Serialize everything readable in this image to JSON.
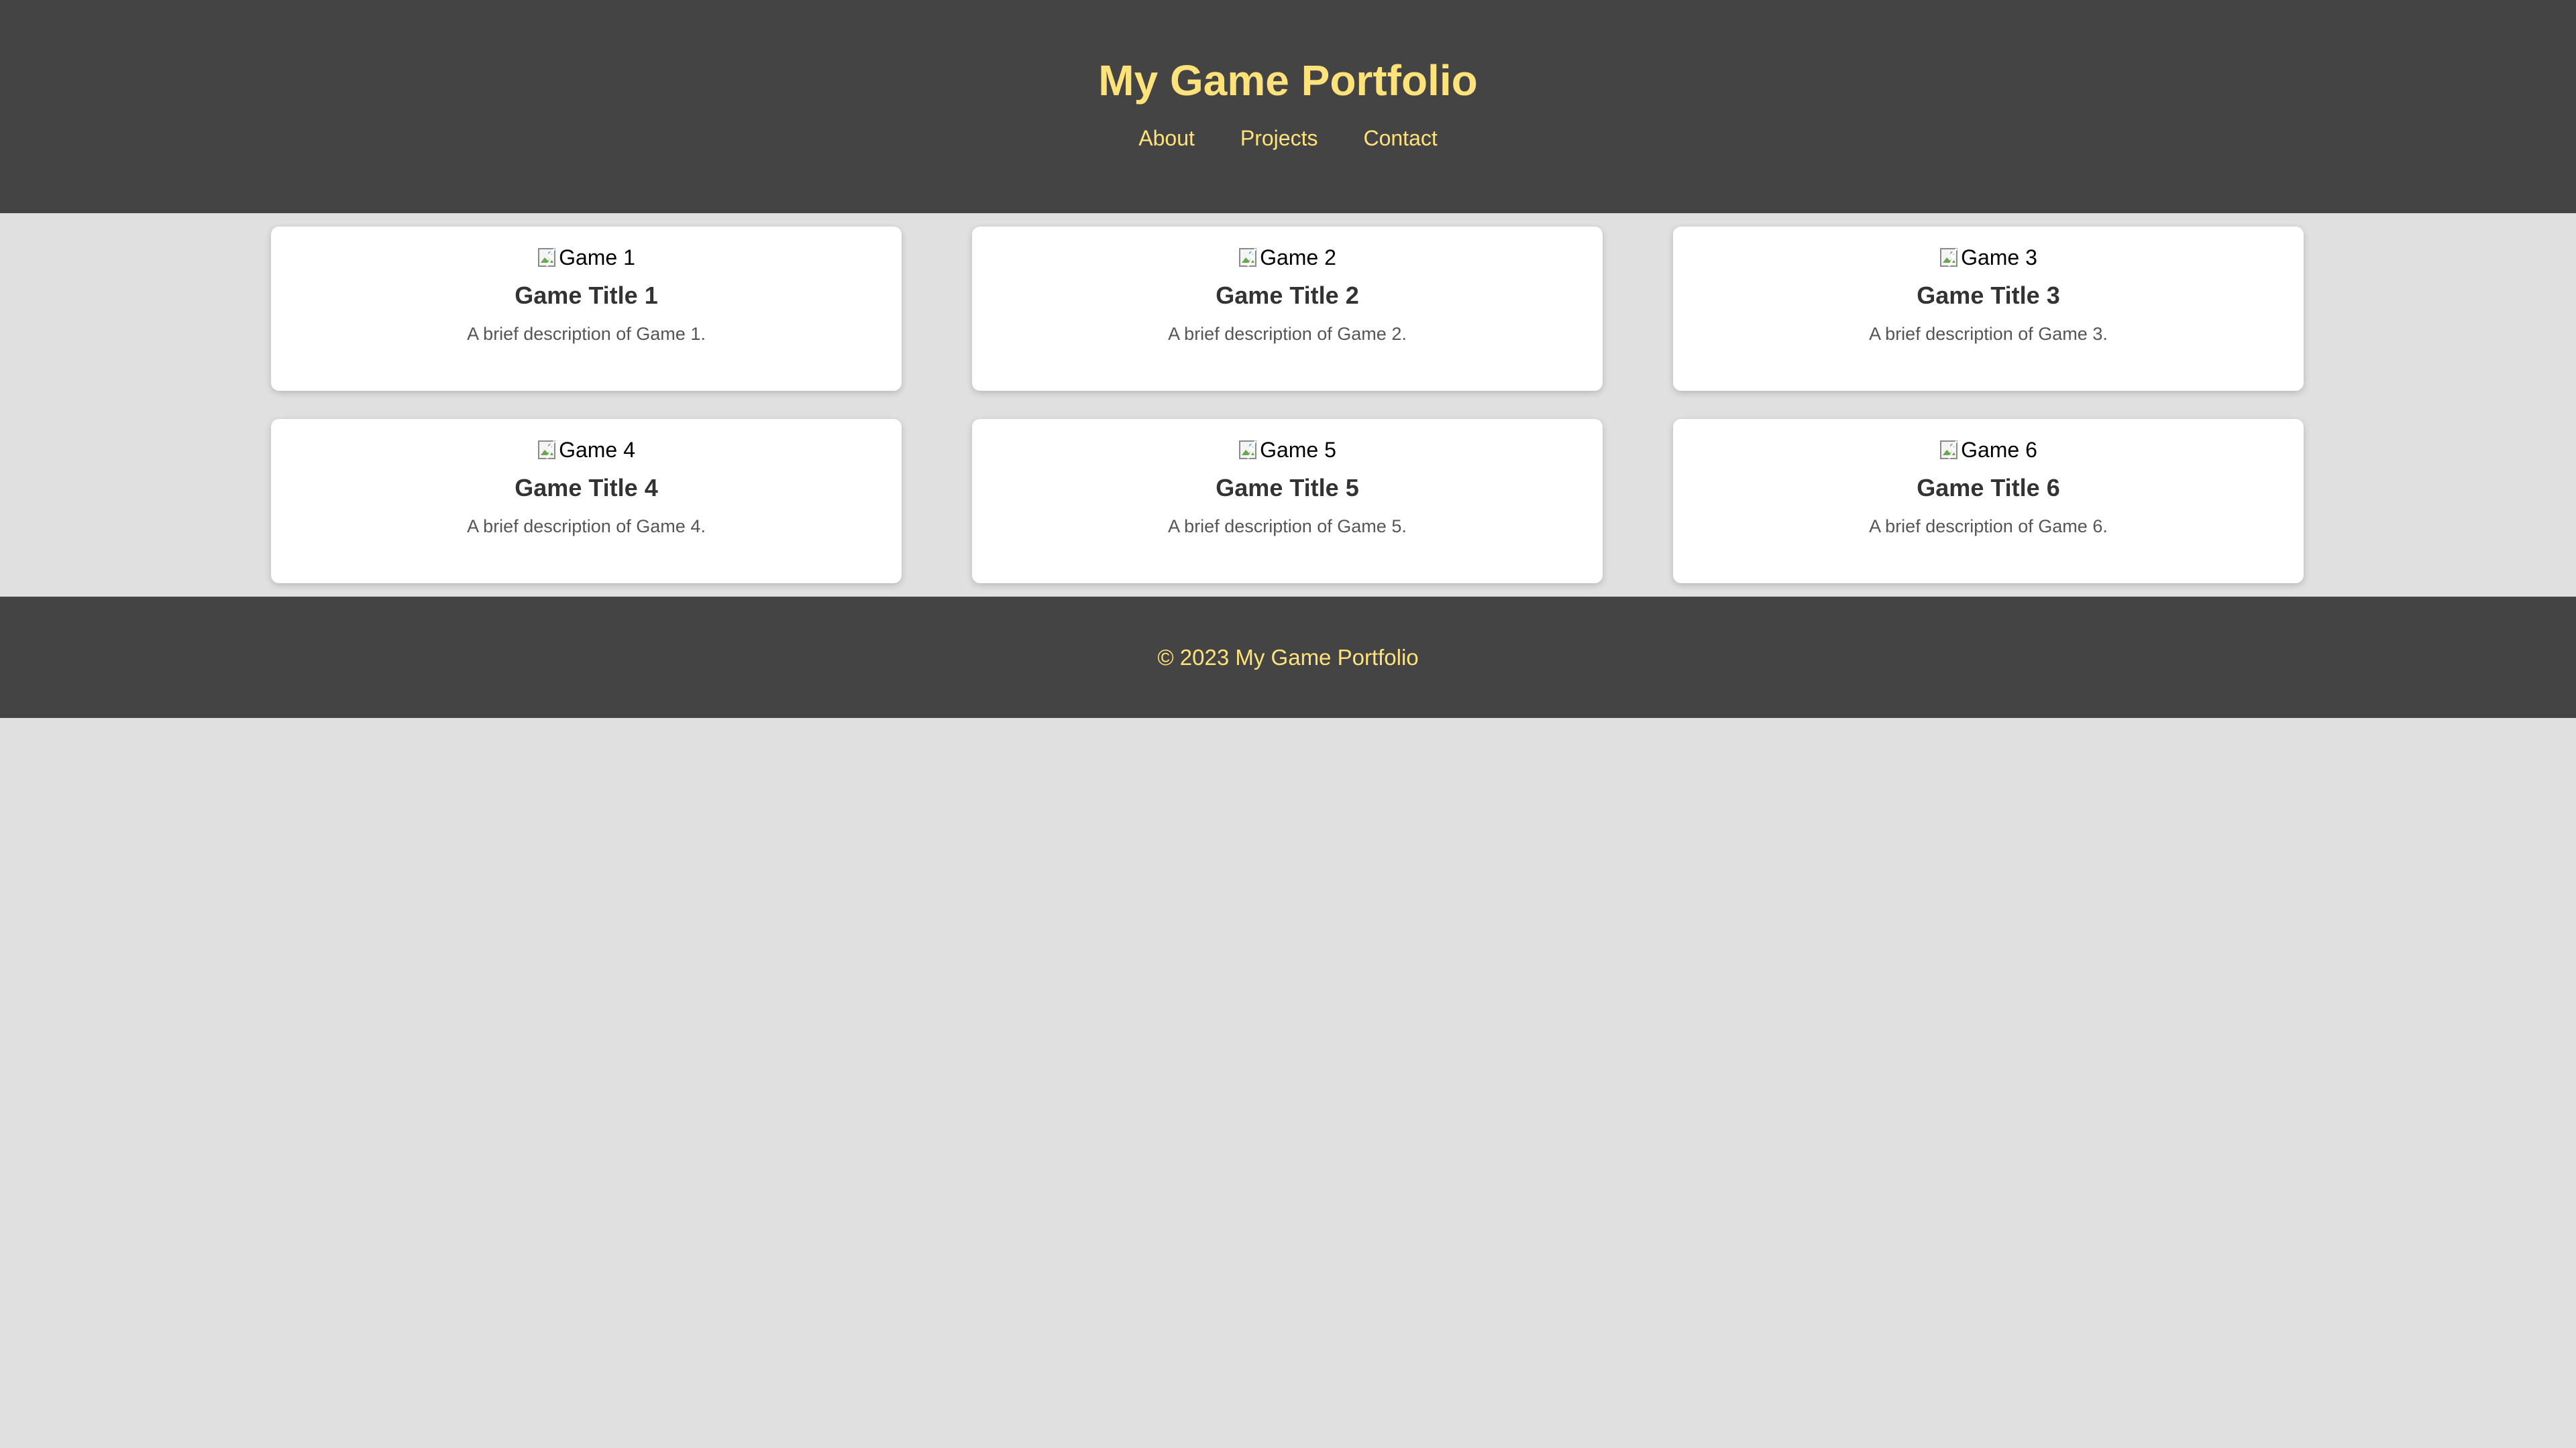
{
  "header": {
    "title": "My Game Portfolio",
    "nav": [
      {
        "label": "About"
      },
      {
        "label": "Projects"
      },
      {
        "label": "Contact"
      }
    ]
  },
  "games": [
    {
      "image_alt": "Game 1",
      "title": "Game Title 1",
      "description": "A brief description of Game 1."
    },
    {
      "image_alt": "Game 2",
      "title": "Game Title 2",
      "description": "A brief description of Game 2."
    },
    {
      "image_alt": "Game 3",
      "title": "Game Title 3",
      "description": "A brief description of Game 3."
    },
    {
      "image_alt": "Game 4",
      "title": "Game Title 4",
      "description": "A brief description of Game 4."
    },
    {
      "image_alt": "Game 5",
      "title": "Game Title 5",
      "description": "A brief description of Game 5."
    },
    {
      "image_alt": "Game 6",
      "title": "Game Title 6",
      "description": "A brief description of Game 6."
    }
  ],
  "footer": {
    "text": "© 2023 My Game Portfolio"
  },
  "colors": {
    "header_bg": "#444444",
    "accent": "#ffe27a",
    "page_bg": "#e0e0e0",
    "card_bg": "#ffffff"
  },
  "icons": {
    "card_image": "broken-image-icon"
  }
}
